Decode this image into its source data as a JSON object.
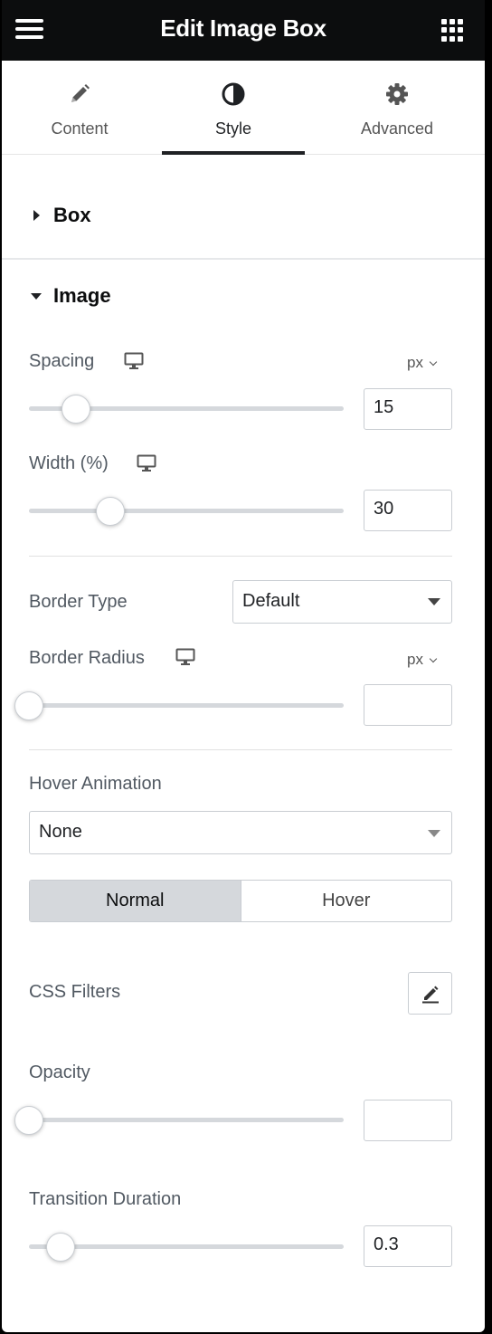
{
  "header": {
    "title": "Edit Image Box",
    "menu_icon": "hamburger-icon",
    "apps_icon": "grid-icon"
  },
  "tabs": [
    {
      "label": "Content",
      "icon": "pencil-icon",
      "active": false
    },
    {
      "label": "Style",
      "icon": "half-circle-icon",
      "active": true
    },
    {
      "label": "Advanced",
      "icon": "gear-icon",
      "active": false
    }
  ],
  "sections": {
    "box": {
      "title": "Box",
      "expanded": false
    },
    "image": {
      "title": "Image",
      "expanded": true
    }
  },
  "controls": {
    "spacing": {
      "label": "Spacing",
      "unit": "px",
      "value": "15",
      "slider_fraction": 0.15
    },
    "width": {
      "label": "Width (%)",
      "value": "30",
      "slider_fraction": 0.26
    },
    "border_type": {
      "label": "Border Type",
      "value": "Default"
    },
    "border_radius": {
      "label": "Border Radius",
      "unit": "px",
      "value": "",
      "slider_fraction": 0.0
    },
    "hover_animation": {
      "label": "Hover Animation",
      "value": "None"
    },
    "state_toggle": {
      "normal": "Normal",
      "hover": "Hover",
      "active": "normal"
    },
    "css_filters": {
      "label": "CSS Filters"
    },
    "opacity": {
      "label": "Opacity",
      "value": "",
      "slider_fraction": 0.0
    },
    "transition_duration": {
      "label": "Transition Duration",
      "value": "0.3",
      "slider_fraction": 0.1
    }
  },
  "colors": {
    "header_bg": "#0c0d0e",
    "text": "#515962",
    "active_toggle": "#d5d8dc"
  }
}
